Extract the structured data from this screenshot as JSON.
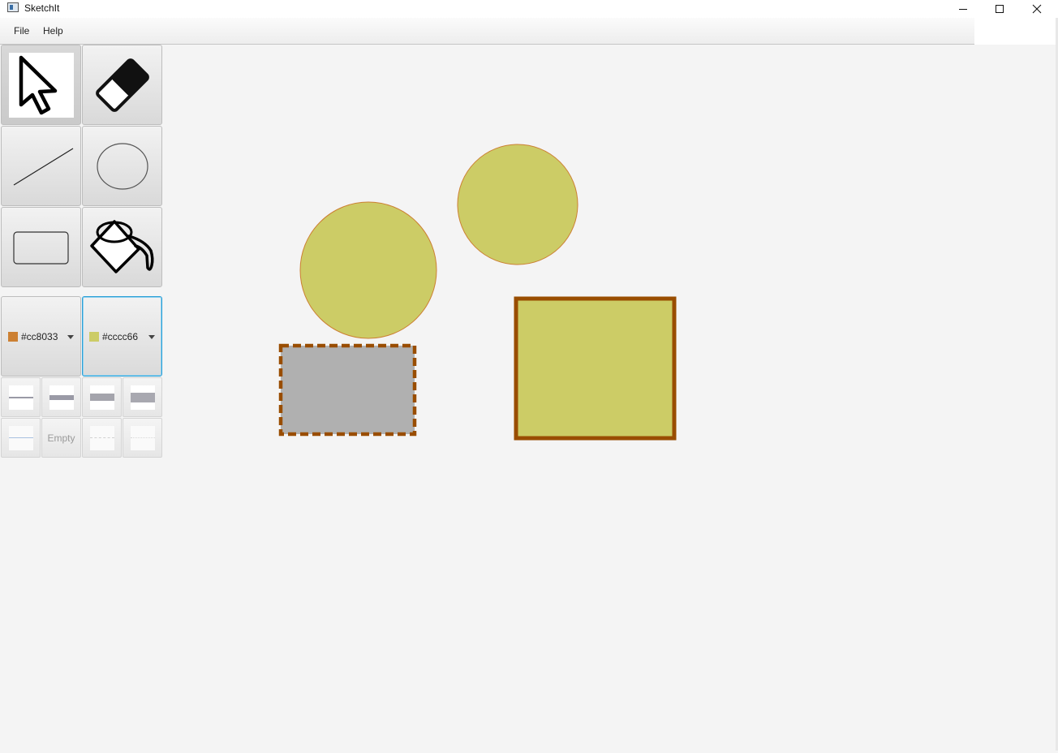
{
  "window": {
    "title": "SketchIt",
    "minimize_icon": "minimize-icon",
    "maximize_icon": "maximize-icon",
    "close_icon": "close-icon"
  },
  "menu": {
    "items": [
      "File",
      "Help"
    ]
  },
  "tools": [
    {
      "name": "select",
      "icon": "cursor-arrow-icon",
      "selected": true
    },
    {
      "name": "erase",
      "icon": "eraser-icon",
      "selected": false
    },
    {
      "name": "line",
      "icon": "line-icon",
      "selected": false
    },
    {
      "name": "circle",
      "icon": "circle-icon",
      "selected": false
    },
    {
      "name": "rectangle",
      "icon": "rectangle-icon",
      "selected": false
    },
    {
      "name": "fill",
      "icon": "paint-bucket-icon",
      "selected": false
    }
  ],
  "colors": {
    "line_color": {
      "label": "#cc8033",
      "value": "#cc8033"
    },
    "fill_color": {
      "label": "#cccc66",
      "value": "#cccc66"
    }
  },
  "line_styles": {
    "thickness": [
      "thin",
      "medium",
      "thick",
      "thickest"
    ],
    "style": [
      "solid",
      "Empty",
      "dashed",
      "dotted"
    ],
    "empty_label": "Empty"
  },
  "canvas": {
    "shapes": [
      {
        "type": "circle",
        "fill": "#cccc66",
        "stroke": "#cc8033",
        "style": "solid"
      },
      {
        "type": "circle",
        "fill": "#cccc66",
        "stroke": "#cc8033",
        "style": "solid"
      },
      {
        "type": "rectangle",
        "fill": "#b0b0b0",
        "stroke": "#994d00",
        "style": "dashed"
      },
      {
        "type": "rectangle",
        "fill": "#cccc66",
        "stroke": "#994d00",
        "style": "solid"
      }
    ]
  }
}
